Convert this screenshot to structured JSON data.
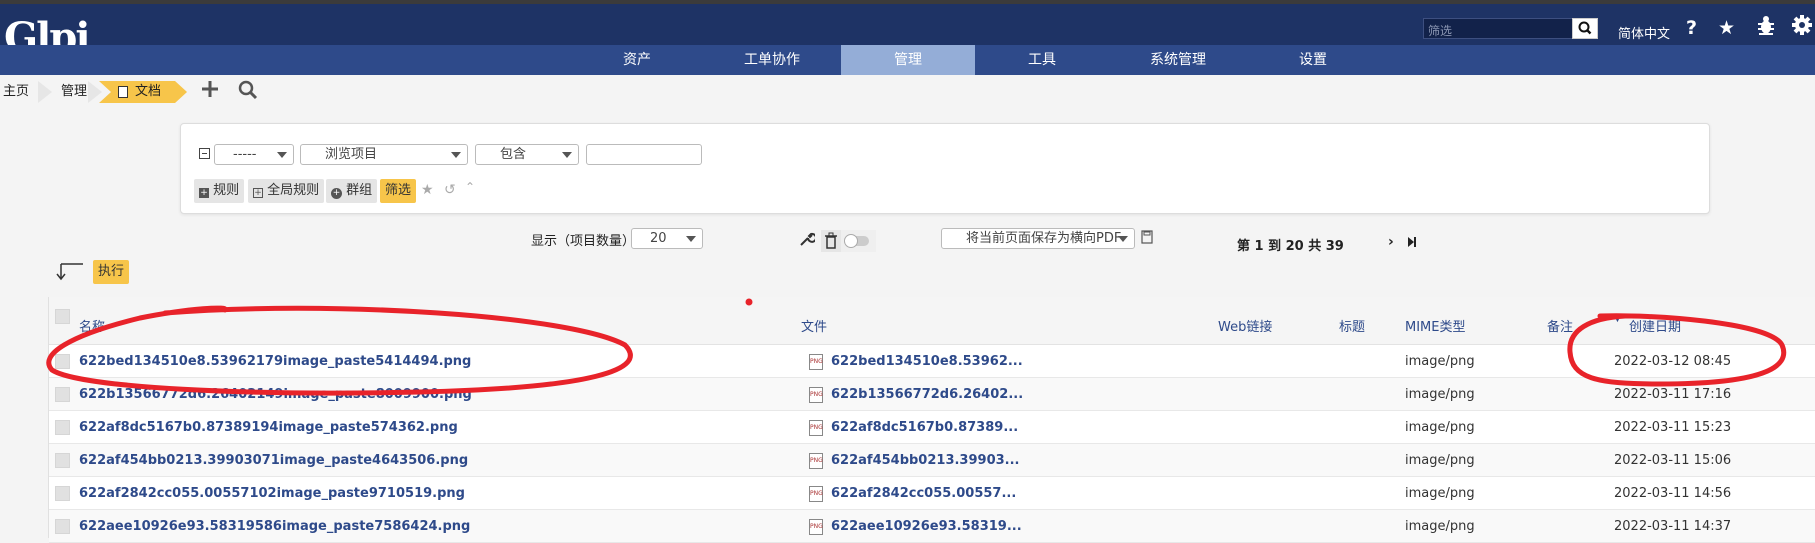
{
  "header": {
    "logo_text": "Glpi",
    "search_placeholder": "筛选",
    "language": "简体中文",
    "icons": [
      "search-icon",
      "help-icon",
      "star-icon",
      "bug-icon",
      "gear-icon"
    ]
  },
  "menu": {
    "items": [
      "资产",
      "工单协作",
      "管理",
      "工具",
      "系统管理",
      "设置"
    ],
    "active": "管理"
  },
  "breadcrumb": {
    "home": "主页",
    "admin": "管理",
    "current": "文档"
  },
  "filter": {
    "select1": "-----",
    "select2": "浏览项目",
    "select3": "包含",
    "value": "",
    "rule_btn": "规则",
    "global_rule_btn": "全局规则",
    "group_btn": "群组",
    "filter_btn": "筛选"
  },
  "controls": {
    "display_label": "显示（项目数量）",
    "page_size": "20",
    "pdf_option": "将当前页面保存为横向PDF",
    "pagination": "第 1 到 20 共 39",
    "execute_btn": "执行"
  },
  "table": {
    "columns": [
      "名称",
      "文件",
      "Web链接",
      "标题",
      "MIME类型",
      "备注",
      "创建日期"
    ],
    "rows": [
      {
        "name": "622bed134510e8.53962179image_paste5414494.png",
        "file": "622bed134510e8.53962...",
        "mime": "image/png",
        "date": "2022-03-12 08:45"
      },
      {
        "name": "622b13566772d6.26402149image_paste8009900.png",
        "file": "622b13566772d6.26402...",
        "mime": "image/png",
        "date": "2022-03-11 17:16"
      },
      {
        "name": "622af8dc5167b0.87389194image_paste574362.png",
        "file": "622af8dc5167b0.87389...",
        "mime": "image/png",
        "date": "2022-03-11 15:23"
      },
      {
        "name": "622af454bb0213.39903071image_paste4643506.png",
        "file": "622af454bb0213.39903...",
        "mime": "image/png",
        "date": "2022-03-11 15:06"
      },
      {
        "name": "622af2842cc055.00557102image_paste9710519.png",
        "file": "622af2842cc055.00557...",
        "mime": "image/png",
        "date": "2022-03-11 14:56"
      },
      {
        "name": "622aee10926e93.58319586image_paste7586424.png",
        "file": "622aee10926e93.58319...",
        "mime": "image/png",
        "date": "2022-03-11 14:37"
      }
    ]
  },
  "colors": {
    "header_bg": "#1e3365",
    "menu_bg": "#2e4a8a",
    "menu_active": "#94add7",
    "accent_yellow": "#f7c54a",
    "link": "#2e4a8a",
    "annotation": "#e8232a"
  }
}
